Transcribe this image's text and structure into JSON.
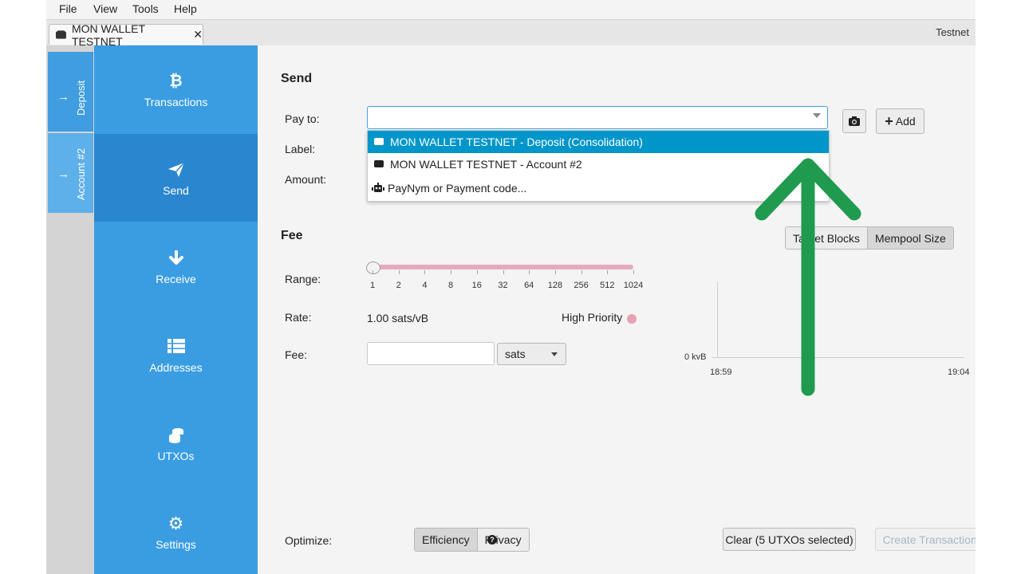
{
  "menu": {
    "file": "File",
    "view": "View",
    "tools": "Tools",
    "help": "Help"
  },
  "tab": {
    "title": "MON WALLET TESTNET",
    "close": "✕"
  },
  "network": "Testnet",
  "accounts": [
    {
      "label": "Deposit"
    },
    {
      "label": "Account #2"
    }
  ],
  "nav": [
    {
      "label": "Transactions",
      "icon": "bitcoin-icon"
    },
    {
      "label": "Send",
      "icon": "paper-plane-icon"
    },
    {
      "label": "Receive",
      "icon": "arrow-down-icon"
    },
    {
      "label": "Addresses",
      "icon": "list-icon"
    },
    {
      "label": "UTXOs",
      "icon": "coins-icon"
    },
    {
      "label": "Settings",
      "icon": "gear-icon"
    }
  ],
  "send": {
    "title": "Send",
    "pay_to_label": "Pay to:",
    "label_label": "Label:",
    "amount_label": "Amount:",
    "pay_to_value": "",
    "dropdown": [
      {
        "label": "MON WALLET TESTNET - Deposit (Consolidation)",
        "icon": "wallet-icon"
      },
      {
        "label": "MON WALLET TESTNET - Account #2",
        "icon": "wallet-icon"
      },
      {
        "label": "PayNym or Payment code...",
        "icon": "robot-icon"
      }
    ],
    "add_label": "Add"
  },
  "fee": {
    "title": "Fee",
    "mode_target": "Target Blocks",
    "mode_mempool": "Mempool Size",
    "range_label": "Range:",
    "ticks": [
      "1",
      "2",
      "4",
      "8",
      "16",
      "32",
      "64",
      "128",
      "256",
      "512",
      "1024"
    ],
    "rate_label": "Rate:",
    "rate_value": "1.00 sats/vB",
    "priority": "High Priority",
    "fee_label": "Fee:",
    "fee_value": "",
    "unit": "sats",
    "chart_y0": "0 kvB",
    "chart_x_start": "18:59",
    "chart_x_end": "19:04"
  },
  "footer": {
    "optimize_label": "Optimize:",
    "efficiency": "Efficiency",
    "privacy": "Privacy",
    "clear": "Clear (5 UTXOs selected)",
    "create": "Create Transaction",
    "create_suffix": "»"
  },
  "colors": {
    "nav": "#3a9de2",
    "nav_active": "#2b86d0",
    "selection": "#0096c9",
    "arrow": "#1f9a4e",
    "priority": "#e6a3b6"
  }
}
